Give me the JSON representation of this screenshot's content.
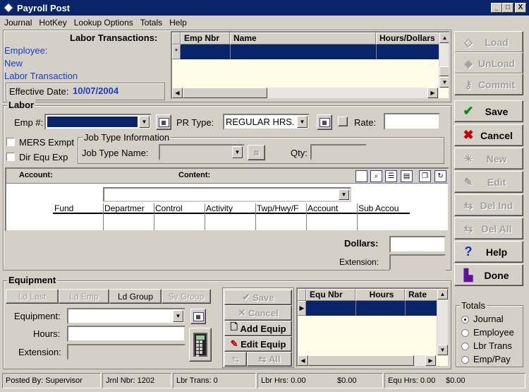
{
  "window": {
    "title": "Payroll Post",
    "minimize": "_",
    "maximize": "□",
    "close": "X"
  },
  "menu": [
    "Journal",
    "HotKey",
    "Lookup Options",
    "Totals",
    "Help"
  ],
  "top": {
    "labor_transactions_label": "Labor Transactions:",
    "employee_label": "Employee:",
    "new_label": "New",
    "labor_transaction_label": "Labor Transaction",
    "effective_date_label": "Effective Date:",
    "effective_date_value": "10/07/2004",
    "grid_columns": [
      "Emp Nbr",
      "Name",
      "Hours/Dollars"
    ],
    "row_marker": "*"
  },
  "labor": {
    "section_label": "Labor",
    "emp_label": "Emp #:",
    "emp_value": "",
    "pr_type_label": "PR Type:",
    "pr_type_value": "REGULAR HRS.",
    "rate_label": "Rate:",
    "rate_value": "",
    "mers_label": "MERS Exmpt",
    "direqu_label": "Dir Equ Exp",
    "job_type_info_label": "Job Type Information",
    "job_type_name_label": "Job Type Name:",
    "qty_label": "Qty:",
    "account_label": "Account:",
    "content_label": "Content:",
    "account_columns": [
      "Fund",
      "Departmer",
      "Control",
      "Activity",
      "Twp/Hwy/F",
      "Account",
      "Sub Accou"
    ],
    "dollars_label": "Dollars:",
    "extension_label": "Extension:"
  },
  "equipment": {
    "section_label": "Equipment",
    "ld_last": "Ld Last",
    "ld_emp": "Ld Emp",
    "ld_group": "Ld Group",
    "sv_group": "Sv Group",
    "equipment_label": "Equipment:",
    "hours_label": "Hours:",
    "extension_label": "Extension:",
    "save": "Save",
    "cancel": "Cancel",
    "add_equip": "Add Equip",
    "edit_equip": "Edit Equip",
    "all": "All",
    "grid_columns": [
      "Equ Nbr",
      "Hours",
      "Rate"
    ]
  },
  "side_buttons": [
    {
      "label": "Load",
      "icon": "load-icon",
      "enabled": false
    },
    {
      "label": "UnLoad",
      "icon": "unload-icon",
      "enabled": false
    },
    {
      "label": "Commit",
      "icon": "commit-icon",
      "enabled": false
    },
    {
      "label": "Save",
      "icon": "check-icon",
      "enabled": true
    },
    {
      "label": "Cancel",
      "icon": "x-icon",
      "enabled": true
    },
    {
      "label": "New",
      "icon": "new-icon",
      "enabled": false
    },
    {
      "label": "Edit",
      "icon": "edit-icon",
      "enabled": false
    },
    {
      "label": "Del Ind",
      "icon": "delete-ind-icon",
      "enabled": false
    },
    {
      "label": "Del All",
      "icon": "delete-all-icon",
      "enabled": false
    },
    {
      "label": "Help",
      "icon": "help-icon",
      "enabled": true
    },
    {
      "label": "Done",
      "icon": "done-icon",
      "enabled": true
    }
  ],
  "totals": {
    "label": "Totals",
    "options": [
      "Journal",
      "Employee",
      "Lbr Trans",
      "Emp/Pay"
    ],
    "selected": "Journal"
  },
  "status": {
    "posted_by": "Posted By: Supervisor",
    "jrnl_nbr": "Jrnl Nbr: 1202",
    "lbr_trans": "Lbr Trans: 0",
    "lbr_hrs": "Lbr Hrs: 0.00",
    "lbr_amt": "$0.00",
    "equ_hrs": "Equ Hrs: 0.00",
    "equ_amt": "$0.00"
  },
  "colors": {
    "titlebar": "#0a246a",
    "selection": "#0a246a",
    "grid_bg": "#fffce8",
    "label_blue": "#1a3cc8"
  }
}
